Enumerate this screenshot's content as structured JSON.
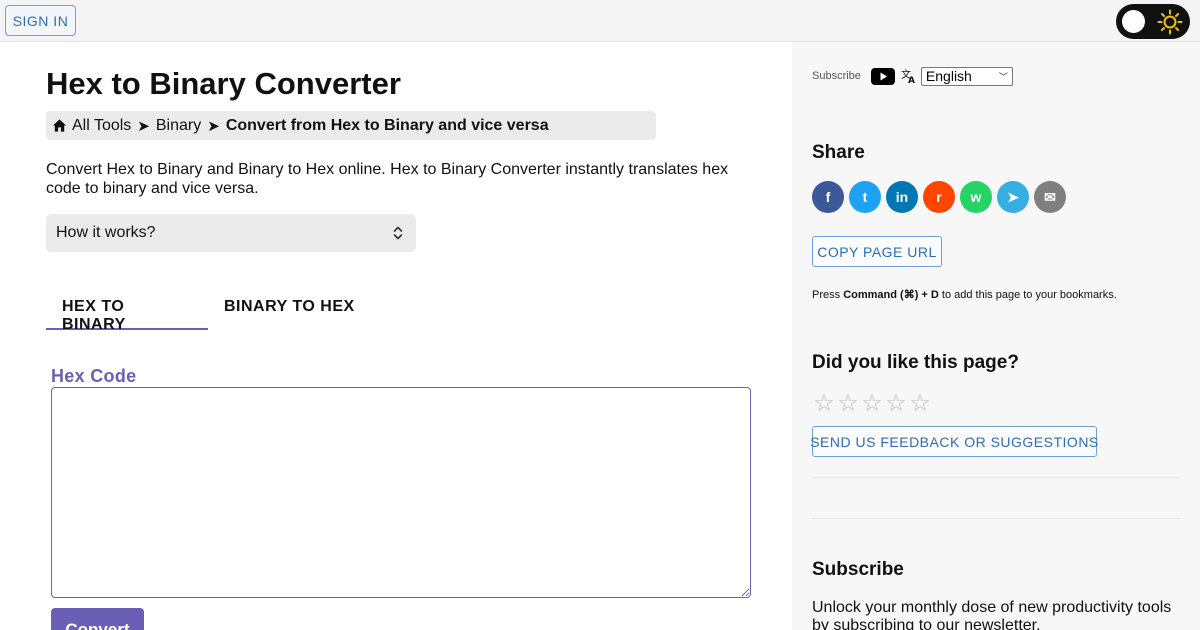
{
  "header": {
    "sign_in_label": "SIGN IN",
    "theme_toggle_icon": "sun-icon"
  },
  "main": {
    "title": "Hex to Binary Converter",
    "breadcrumb": {
      "home_icon": "home-icon",
      "items": [
        "All Tools",
        "Binary"
      ],
      "separator": "➤",
      "current": "Convert from Hex to Binary and vice versa"
    },
    "intro": "Convert Hex to Binary and Binary to Hex online. Hex to Binary Converter instantly translates hex code to binary and vice versa.",
    "how_it_works_label": "How it works?",
    "tabs": [
      {
        "label": "HEX TO BINARY",
        "active": true
      },
      {
        "label": "BINARY TO HEX",
        "active": false
      }
    ],
    "field_label": "Hex Code",
    "input_value": "",
    "convert_label": "Convert"
  },
  "sidebar": {
    "subscribe_small": "Subscribe",
    "language_selected": "English",
    "share_title": "Share",
    "share_icons": [
      {
        "name": "facebook-icon",
        "color": "#3b5998",
        "glyph": "f"
      },
      {
        "name": "twitter-icon",
        "color": "#1da1f2",
        "glyph": "t"
      },
      {
        "name": "linkedin-icon",
        "color": "#0077b5",
        "glyph": "in"
      },
      {
        "name": "reddit-icon",
        "color": "#ff4500",
        "glyph": "r"
      },
      {
        "name": "whatsapp-icon",
        "color": "#25d366",
        "glyph": "w"
      },
      {
        "name": "telegram-icon",
        "color": "#37aee2",
        "glyph": "➤"
      },
      {
        "name": "email-icon",
        "color": "#7f7f7f",
        "glyph": "✉"
      }
    ],
    "copy_url_label": "COPY PAGE URL",
    "bookmark_prefix": "Press ",
    "bookmark_keys": "Command (⌘) + D",
    "bookmark_suffix": " to add this page to your bookmarks.",
    "rating_title": "Did you like this page?",
    "rating_value": 0,
    "rating_max": 5,
    "feedback_label": "SEND US FEEDBACK OR SUGGESTIONS",
    "subscribe_title": "Subscribe",
    "subscribe_text": "Unlock your monthly dose of new productivity tools by subscribing to our newsletter."
  },
  "colors": {
    "accent": "#6b5fb5",
    "link_blue": "#2f6db5"
  }
}
